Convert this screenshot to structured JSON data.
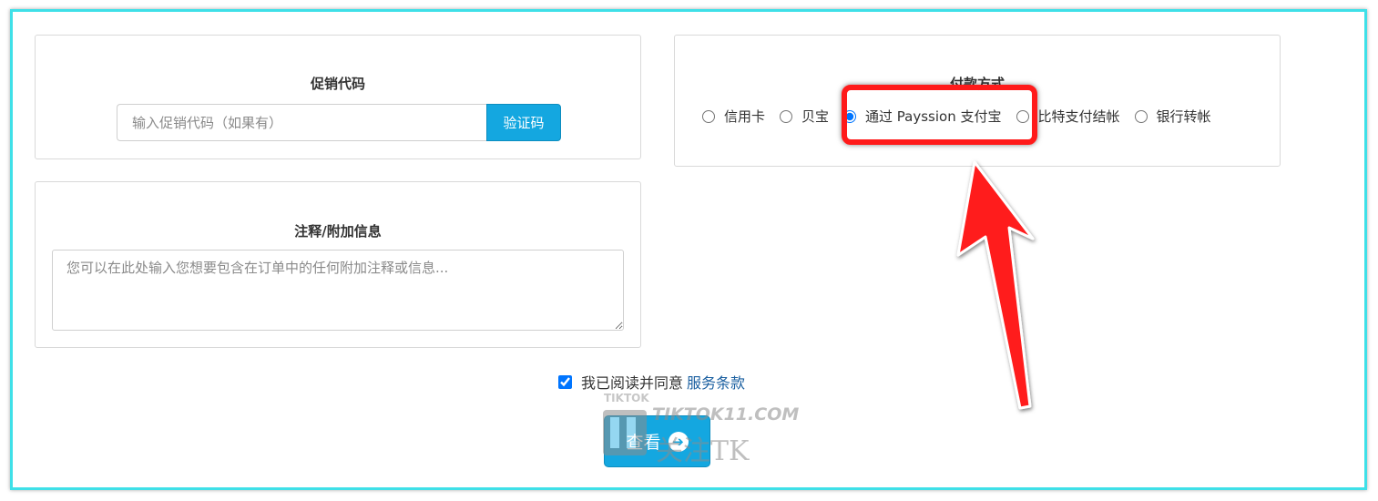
{
  "promo": {
    "title": "促销代码",
    "placeholder": "输入促销代码（如果有）",
    "button": "验证码"
  },
  "notes": {
    "title": "注释/附加信息",
    "placeholder": "您可以在此处输入您想要包含在订单中的任何附加注释或信息..."
  },
  "payment": {
    "title": "付款方式",
    "options": [
      {
        "label": "信用卡",
        "selected": false
      },
      {
        "label": "贝宝",
        "selected": false
      },
      {
        "label": "通过 Payssion 支付宝",
        "selected": true
      },
      {
        "label": "比特支付结帐",
        "selected": false
      },
      {
        "label": "银行转帐",
        "selected": false
      }
    ]
  },
  "agree": {
    "text": "我已阅读并同意",
    "link": "服务条款",
    "checked": true
  },
  "submit": {
    "label": "查看"
  },
  "watermark": {
    "top": "TIKTOK",
    "domain": "TIKTOK11.COM",
    "brand": "关注TK"
  },
  "annotation": {
    "color": "#ff1a1a"
  },
  "colors": {
    "accent": "#14a7e0",
    "frame": "#3fe0e8",
    "link": "#1a5fa0"
  }
}
